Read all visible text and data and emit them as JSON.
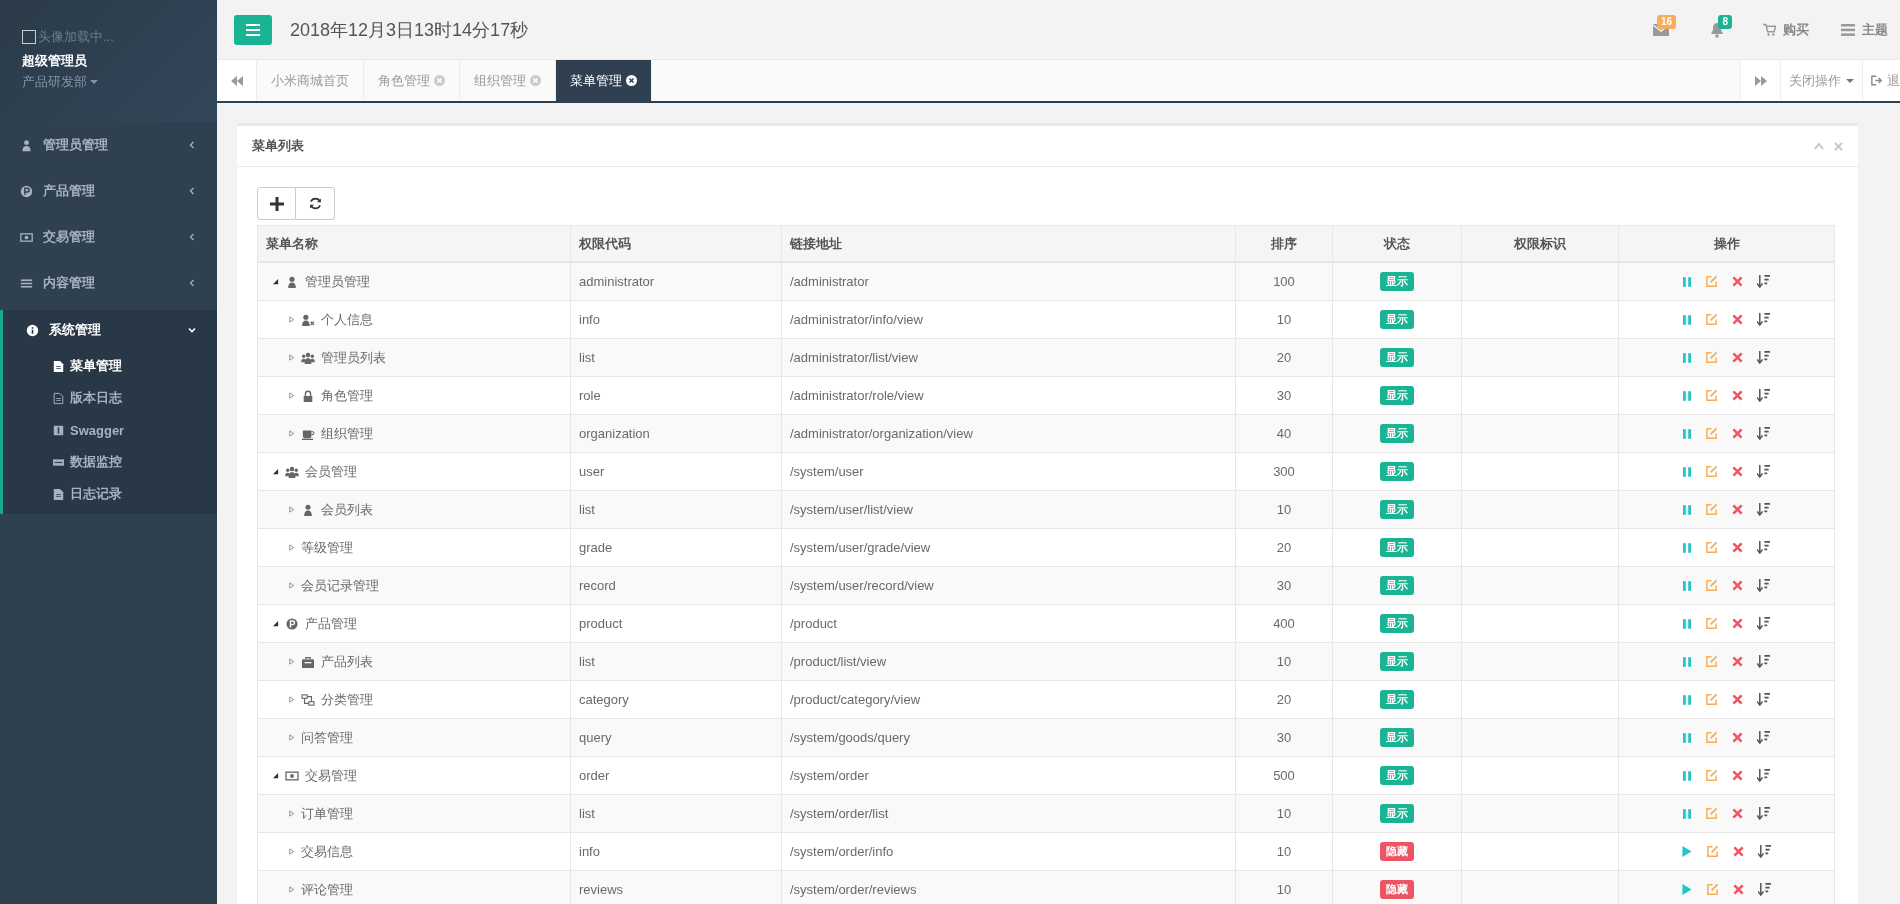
{
  "sidebar": {
    "avatar_alt": "头像加载中...",
    "user_name": "超级管理员",
    "department": "产品研发部",
    "items": [
      {
        "label": "管理员管理",
        "kind": "user",
        "expanded": false,
        "selected": false
      },
      {
        "label": "产品管理",
        "kind": "product",
        "expanded": false,
        "selected": false
      },
      {
        "label": "交易管理",
        "kind": "money",
        "expanded": false,
        "selected": false
      },
      {
        "label": "内容管理",
        "kind": "bars",
        "expanded": false,
        "selected": false
      },
      {
        "label": "系统管理",
        "kind": "info",
        "expanded": true,
        "selected": true,
        "children": [
          {
            "label": "菜单管理",
            "kind": "file",
            "selected": true
          },
          {
            "label": "版本日志",
            "kind": "file-text",
            "selected": false
          },
          {
            "label": "Swagger",
            "kind": "square",
            "selected": false
          },
          {
            "label": "数据监控",
            "kind": "monitor",
            "selected": false
          },
          {
            "label": "日志记录",
            "kind": "file",
            "selected": false
          }
        ]
      }
    ]
  },
  "header": {
    "datetime": "2018年12月3日13时14分17秒",
    "mail_count": "16",
    "notice_count": "8",
    "buy": "购买",
    "theme": "主题"
  },
  "tabs": [
    {
      "label": "小米商城首页",
      "selected": false,
      "closable": false
    },
    {
      "label": "角色管理",
      "selected": false,
      "closable": true
    },
    {
      "label": "组织管理",
      "selected": false,
      "closable": true
    },
    {
      "label": "菜单管理",
      "selected": true,
      "closable": true
    }
  ],
  "tab_actions": {
    "close_ops": "关闭操作",
    "logout": "退"
  },
  "panel": {
    "title": "菜单列表"
  },
  "table": {
    "columns": [
      "菜单名称",
      "权限代码",
      "链接地址",
      "排序",
      "状态",
      "权限标识",
      "操作"
    ],
    "rows": [
      {
        "name": "管理员管理",
        "kind": "user",
        "code": "administrator",
        "link": "/administrator",
        "sort": "100",
        "status": "显示",
        "visible": true,
        "expanded": true,
        "children": [
          {
            "name": "个人信息",
            "kind": "user-x",
            "code": "info",
            "link": "/administrator/info/view",
            "sort": "10",
            "status": "显示",
            "visible": true,
            "expanded": false
          },
          {
            "name": "管理员列表",
            "kind": "users",
            "code": "list",
            "link": "/administrator/list/view",
            "sort": "20",
            "status": "显示",
            "visible": true,
            "expanded": false
          },
          {
            "name": "角色管理",
            "kind": "lock",
            "code": "role",
            "link": "/administrator/role/view",
            "sort": "30",
            "status": "显示",
            "visible": true,
            "expanded": false
          },
          {
            "name": "组织管理",
            "kind": "coffee",
            "code": "organization",
            "link": "/administrator/organization/view",
            "sort": "40",
            "status": "显示",
            "visible": true,
            "expanded": false
          }
        ]
      },
      {
        "name": "会员管理",
        "kind": "users",
        "code": "user",
        "link": "/system/user",
        "sort": "300",
        "status": "显示",
        "visible": true,
        "expanded": true,
        "children": [
          {
            "name": "会员列表",
            "kind": "user",
            "code": "list",
            "link": "/system/user/list/view",
            "sort": "10",
            "status": "显示",
            "visible": true,
            "expanded": false
          },
          {
            "name": "等级管理",
            "code": "grade",
            "link": "/system/user/grade/view",
            "sort": "20",
            "status": "显示",
            "visible": true,
            "expanded": false
          },
          {
            "name": "会员记录管理",
            "code": "record",
            "link": "/system/user/record/view",
            "sort": "30",
            "status": "显示",
            "visible": true,
            "expanded": false
          }
        ]
      },
      {
        "name": "产品管理",
        "kind": "product",
        "code": "product",
        "link": "/product",
        "sort": "400",
        "status": "显示",
        "visible": true,
        "expanded": true,
        "children": [
          {
            "name": "产品列表",
            "kind": "briefcase",
            "code": "list",
            "link": "/product/list/view",
            "sort": "10",
            "status": "显示",
            "visible": true,
            "expanded": false
          },
          {
            "name": "分类管理",
            "kind": "sitemap",
            "code": "category",
            "link": "/product/category/view",
            "sort": "20",
            "status": "显示",
            "visible": true,
            "expanded": false
          },
          {
            "name": "问答管理",
            "code": "query",
            "link": "/system/goods/query",
            "sort": "30",
            "status": "显示",
            "visible": true,
            "expanded": false
          }
        ]
      },
      {
        "name": "交易管理",
        "kind": "money",
        "code": "order",
        "link": "/system/order",
        "sort": "500",
        "status": "显示",
        "visible": true,
        "expanded": true,
        "children": [
          {
            "name": "订单管理",
            "code": "list",
            "link": "/system/order/list",
            "sort": "10",
            "status": "显示",
            "visible": true,
            "expanded": false
          },
          {
            "name": "交易信息",
            "code": "info",
            "link": "/system/order/info",
            "sort": "10",
            "status": "隐藏",
            "visible": false,
            "expanded": false
          },
          {
            "name": "评论管理",
            "code": "reviews",
            "link": "/system/order/reviews",
            "sort": "10",
            "status": "隐藏",
            "visible": false,
            "expanded": false
          }
        ]
      }
    ]
  }
}
